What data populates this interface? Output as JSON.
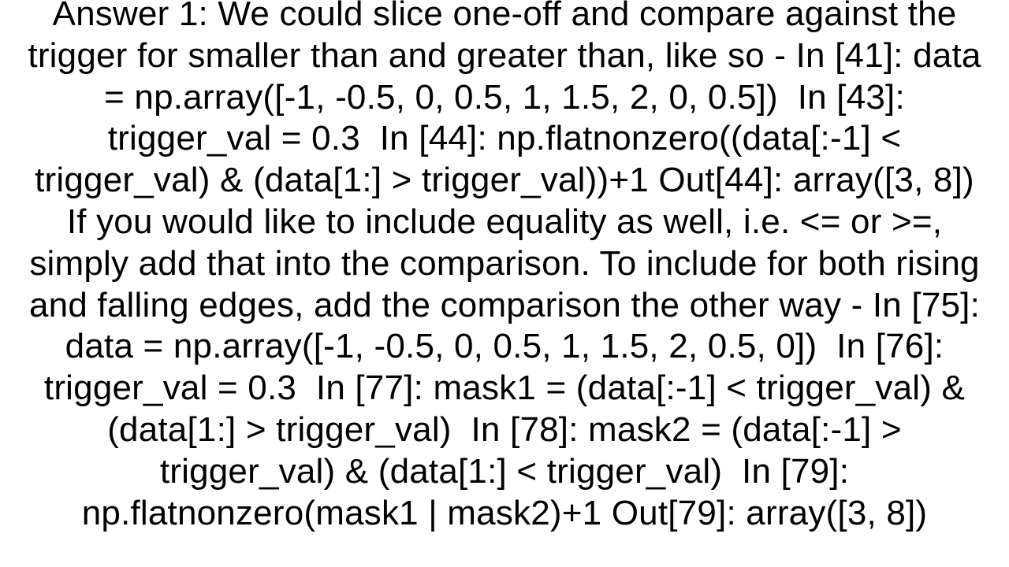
{
  "answer": {
    "text": "Answer 1: We could slice one-off and compare against the trigger for smaller than and greater than, like so - In [41]: data = np.array([-1, -0.5, 0, 0.5, 1, 1.5, 2, 0, 0.5])  In [43]: trigger_val = 0.3  In [44]: np.flatnonzero((data[:-1] < trigger_val) & (data[1:] > trigger_val))+1 Out[44]: array([3, 8])  If you would like to include equality as well, i.e. <= or >=, simply add that into the comparison. To include for both rising and falling edges, add the comparison the other way - In [75]: data = np.array([-1, -0.5, 0, 0.5, 1, 1.5, 2, 0.5, 0])  In [76]: trigger_val = 0.3  In [77]: mask1 = (data[:-1] < trigger_val) & (data[1:] > trigger_val)  In [78]: mask2 = (data[:-1] > trigger_val) & (data[1:] < trigger_val)  In [79]: np.flatnonzero(mask1 | mask2)+1 Out[79]: array([3, 8])"
  }
}
